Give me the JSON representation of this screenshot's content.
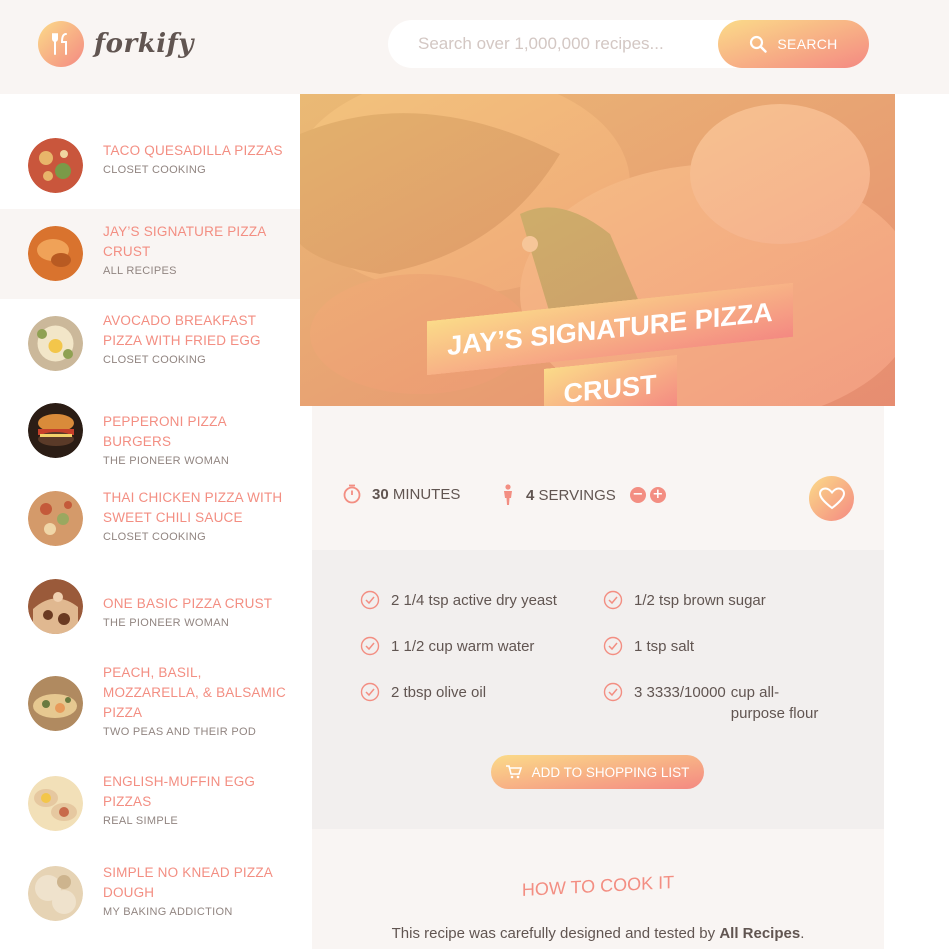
{
  "header": {
    "logo_text": "forkify",
    "search_placeholder": "Search over 1,000,000 recipes...",
    "search_label": "SEARCH"
  },
  "results": [
    {
      "title": "TACO QUESADILLA PIZZAS",
      "publisher": "CLOSET COOKING",
      "active": false,
      "thumb_colors": [
        "#c9563c",
        "#e8b56a",
        "#7a9a48"
      ]
    },
    {
      "title": "JAY’S SIGNATURE PIZZA CRUST",
      "publisher": "ALL RECIPES",
      "active": true,
      "thumb_colors": [
        "#d9732e",
        "#f0a258",
        "#b85a22"
      ]
    },
    {
      "title": "AVOCADO BREAKFAST PIZZA WITH FRIED EGG",
      "publisher": "CLOSET COOKING",
      "active": false,
      "thumb_colors": [
        "#cbb89a",
        "#8fa152",
        "#f2e6c8"
      ]
    },
    {
      "title": "PEPPERONI PIZZA BURGERS",
      "publisher": "THE PIONEER WOMAN",
      "active": false,
      "thumb_colors": [
        "#5a3a28",
        "#d98b3a",
        "#2b1d15"
      ]
    },
    {
      "title": "THAI CHICKEN PIZZA WITH SWEET CHILI SAUCE",
      "publisher": "CLOSET COOKING",
      "active": false,
      "thumb_colors": [
        "#d49a6a",
        "#c45a3a",
        "#9aa860"
      ]
    },
    {
      "title": "ONE BASIC PIZZA CRUST",
      "publisher": "THE PIONEER WOMAN",
      "active": false,
      "thumb_colors": [
        "#9a5a3a",
        "#e0b890",
        "#6a3a22"
      ]
    },
    {
      "title": "PEACH, BASIL, MOZZARELLA, & BALSAMIC PIZZA",
      "publisher": "TWO PEAS AND THEIR POD",
      "active": false,
      "thumb_colors": [
        "#b08a60",
        "#e6c890",
        "#6a7a40"
      ]
    },
    {
      "title": "ENGLISH-MUFFIN EGG PIZZAS",
      "publisher": "REAL SIMPLE",
      "active": false,
      "thumb_colors": [
        "#e6c8a0",
        "#f2e0b8",
        "#c86a4a"
      ]
    },
    {
      "title": "SIMPLE NO KNEAD PIZZA DOUGH",
      "publisher": "MY BAKING ADDICTION",
      "active": false,
      "thumb_colors": [
        "#efe2cc",
        "#e6d3b4",
        "#cdb48e"
      ]
    }
  ],
  "recipe": {
    "title": "JAY’S SIGNATURE PIZZA CRUST",
    "minutes": "30",
    "minutes_label": "MINUTES",
    "servings": "4",
    "servings_label": "SERVINGS",
    "ingredients": [
      {
        "count": "2 1/4",
        "text": "tsp active dry yeast"
      },
      {
        "count": "1/2",
        "text": "tsp brown sugar"
      },
      {
        "count": "1 1/2",
        "text": "cup warm water"
      },
      {
        "count": "1",
        "text": "tsp salt"
      },
      {
        "count": "2",
        "text": "tbsp olive oil"
      },
      {
        "count": "3 3333/10000",
        "text": "cup all-purpose flour"
      }
    ],
    "shopping_label": "ADD TO SHOPPING LIST",
    "directions_heading": "HOW TO COOK IT",
    "directions_text_prefix": "This recipe was carefully designed and tested by ",
    "publisher": "All Recipes",
    "directions_text_suffix": "."
  },
  "colors": {
    "accent_start": "#fbdb89",
    "accent_end": "#f48982",
    "title_color": "#f38e82",
    "text_color": "#615551",
    "bg_light": "#f9f5f3"
  }
}
